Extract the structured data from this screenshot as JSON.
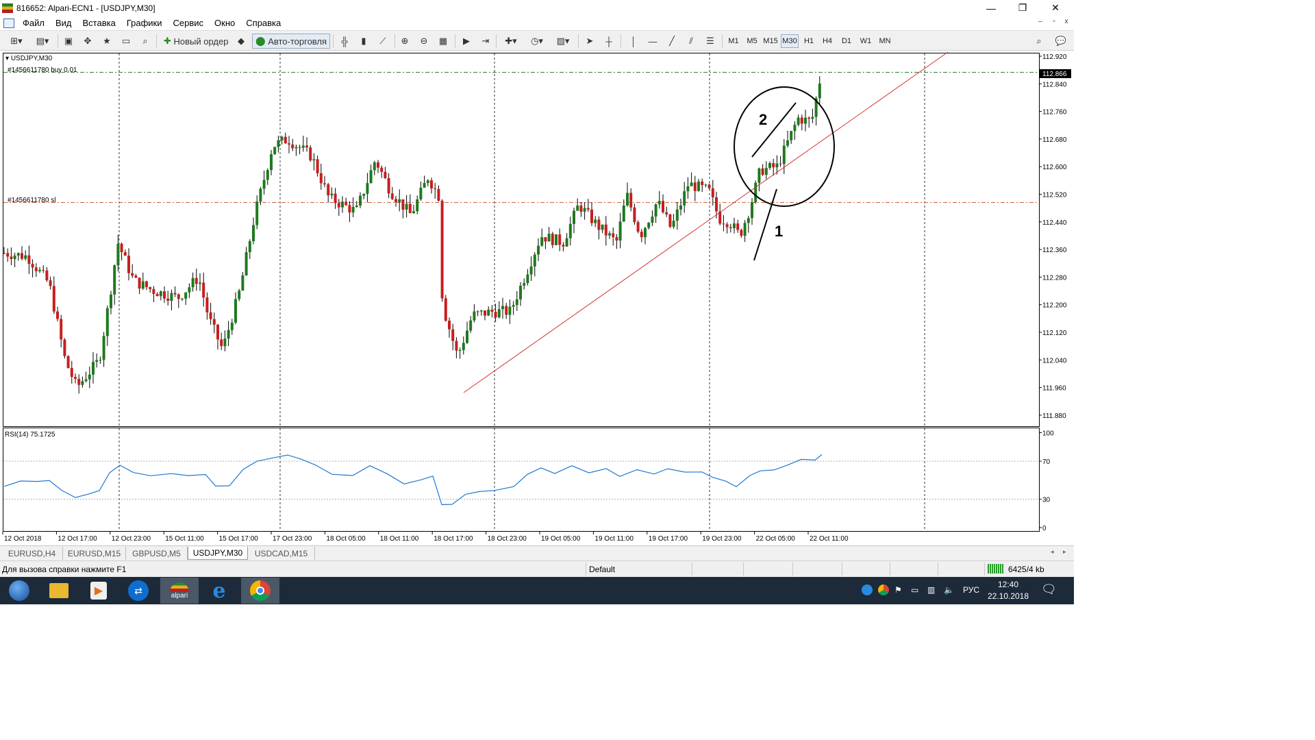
{
  "window": {
    "title": "816652: Alpari-ECN1 - [USDJPY,M30]",
    "controls": [
      "—",
      "❐",
      "✕"
    ],
    "mdi_controls": [
      "–",
      "▫",
      "x"
    ]
  },
  "menu": [
    "Файл",
    "Вид",
    "Вставка",
    "Графики",
    "Сервис",
    "Окно",
    "Справка"
  ],
  "toolbar": {
    "new_order_label": "Новый ордер",
    "auto_trading_label": "Авто-торговля",
    "timeframes": [
      "M1",
      "M5",
      "M15",
      "M30",
      "H1",
      "H4",
      "D1",
      "W1",
      "MN"
    ],
    "active_timeframe": "M30"
  },
  "chart": {
    "symbol_label": "USDJPY,M30",
    "order_line_label": "#1456611780 buy 0.01",
    "sl_line_label": "#1456611780 sl",
    "current_price": "112.866",
    "price_labels": [
      "112.920",
      "112.840",
      "112.760",
      "112.680",
      "112.600",
      "112.520",
      "112.440",
      "112.360",
      "112.280",
      "112.200",
      "112.120",
      "112.040",
      "111.960",
      "111.880"
    ],
    "rsi_label": "RSI(14) 75.1725",
    "rsi_levels": [
      "100",
      "70",
      "30",
      "0"
    ],
    "time_labels": [
      "12 Oct 2018",
      "12 Oct 17:00",
      "12 Oct 23:00",
      "15 Oct 11:00",
      "15 Oct 17:00",
      "17 Oct 23:00",
      "18 Oct 05:00",
      "18 Oct 11:00",
      "18 Oct 17:00",
      "18 Oct 23:00",
      "19 Oct 05:00",
      "19 Oct 11:00",
      "19 Oct 17:00",
      "19 Oct 23:00",
      "22 Oct 05:00",
      "22 Oct 11:00"
    ],
    "annotation_1": "1",
    "annotation_2": "2",
    "colors": {
      "bull": "#1e7a1e",
      "bear": "#c81e1e",
      "trendline": "#d23232",
      "order_line": "#2e7d32",
      "sl_line": "#d06040",
      "rsi_line": "#1e78d2",
      "grid": "#000000"
    }
  },
  "tabs": [
    "EURUSD,H4",
    "EURUSD,M15",
    "GBPUSD,M5",
    "USDJPY,M30",
    "USDCAD,M15"
  ],
  "active_tab": "USDJPY,M30",
  "status": {
    "help": "Для вызова справки нажмите F1",
    "profile": "Default",
    "traffic": "6425/4 kb"
  },
  "taskbar": {
    "alpari_label": "alpari",
    "lang": "РУС",
    "time": "12:40",
    "date": "22.10.2018"
  }
}
